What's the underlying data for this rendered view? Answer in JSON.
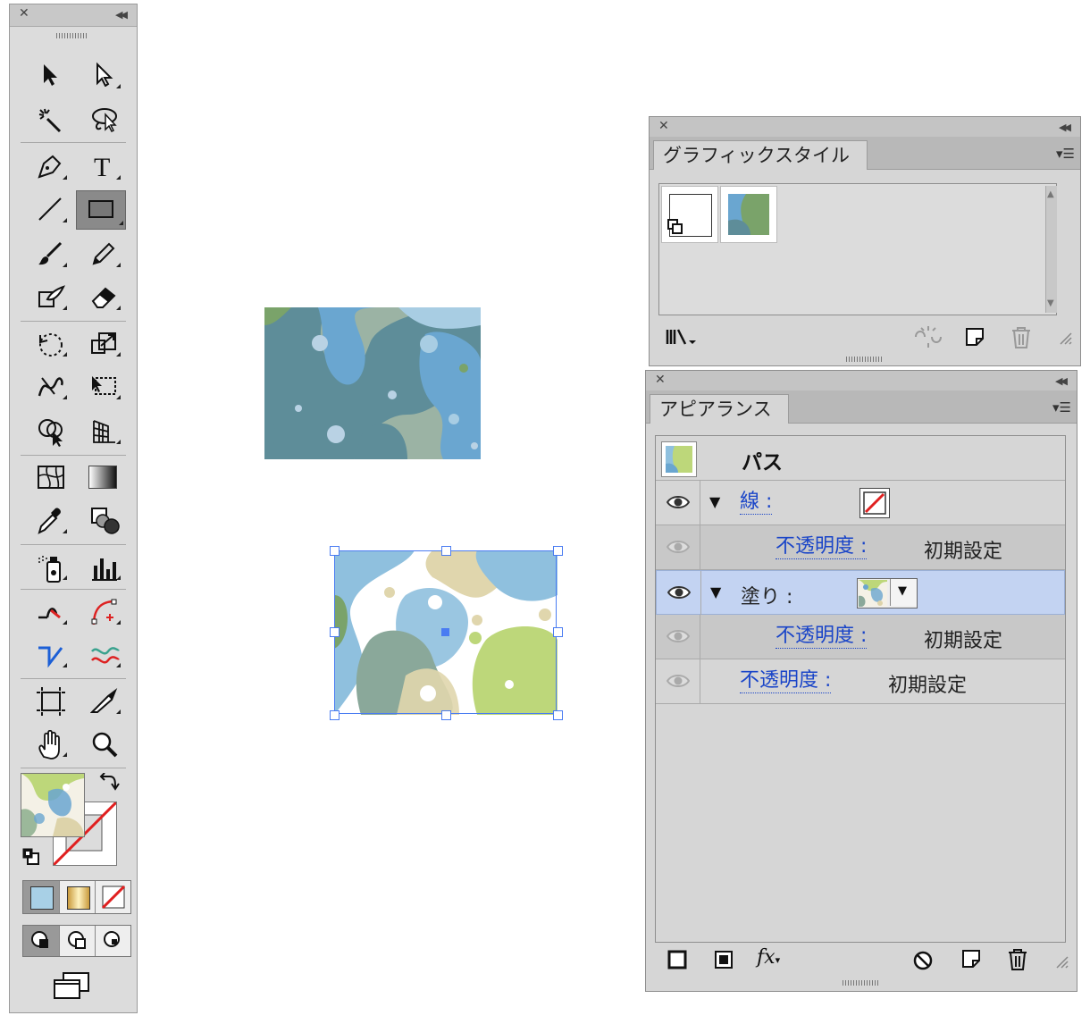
{
  "graphic_styles_panel": {
    "title": "グラフィックスタイル",
    "swatches": [
      "default-style",
      "pattern-style"
    ]
  },
  "appearance_panel": {
    "title": "アピアランス",
    "object_label": "パス",
    "rows": [
      {
        "label": "線 :",
        "value": ""
      },
      {
        "label": "不透明度 :",
        "value": "初期設定"
      },
      {
        "label": "塗り :",
        "value": ""
      },
      {
        "label": "不透明度 :",
        "value": "初期設定"
      },
      {
        "label": "不透明度 :",
        "value": "初期設定"
      }
    ]
  },
  "colors": {
    "selection": "#4a7cf2",
    "highlight_row": "#c3d3f2",
    "link_text": "#1a45c8",
    "pattern_blue": "#6aa6d0",
    "pattern_green": "#9bb89a",
    "pattern_lime": "#bdd77a",
    "pattern_tan": "#ddd3aa"
  },
  "tools": [
    "selection-tool",
    "direct-selection-tool",
    "magic-wand-tool",
    "lasso-tool",
    "pen-tool",
    "type-tool",
    "line-tool",
    "rectangle-tool",
    "paintbrush-tool",
    "pencil-tool",
    "blob-brush-tool",
    "eraser-tool",
    "rotate-tool",
    "scale-tool",
    "warp-tool",
    "free-transform-tool",
    "shape-builder-tool",
    "perspective-grid-tool",
    "mesh-tool",
    "gradient-tool",
    "eyedropper-tool",
    "blend-tool",
    "symbol-sprayer-tool",
    "column-graph-tool",
    "width-tool",
    "curvature-tool",
    "join-tool",
    "smooth-tool",
    "artboard-tool",
    "slice-tool",
    "hand-tool",
    "zoom-tool"
  ]
}
